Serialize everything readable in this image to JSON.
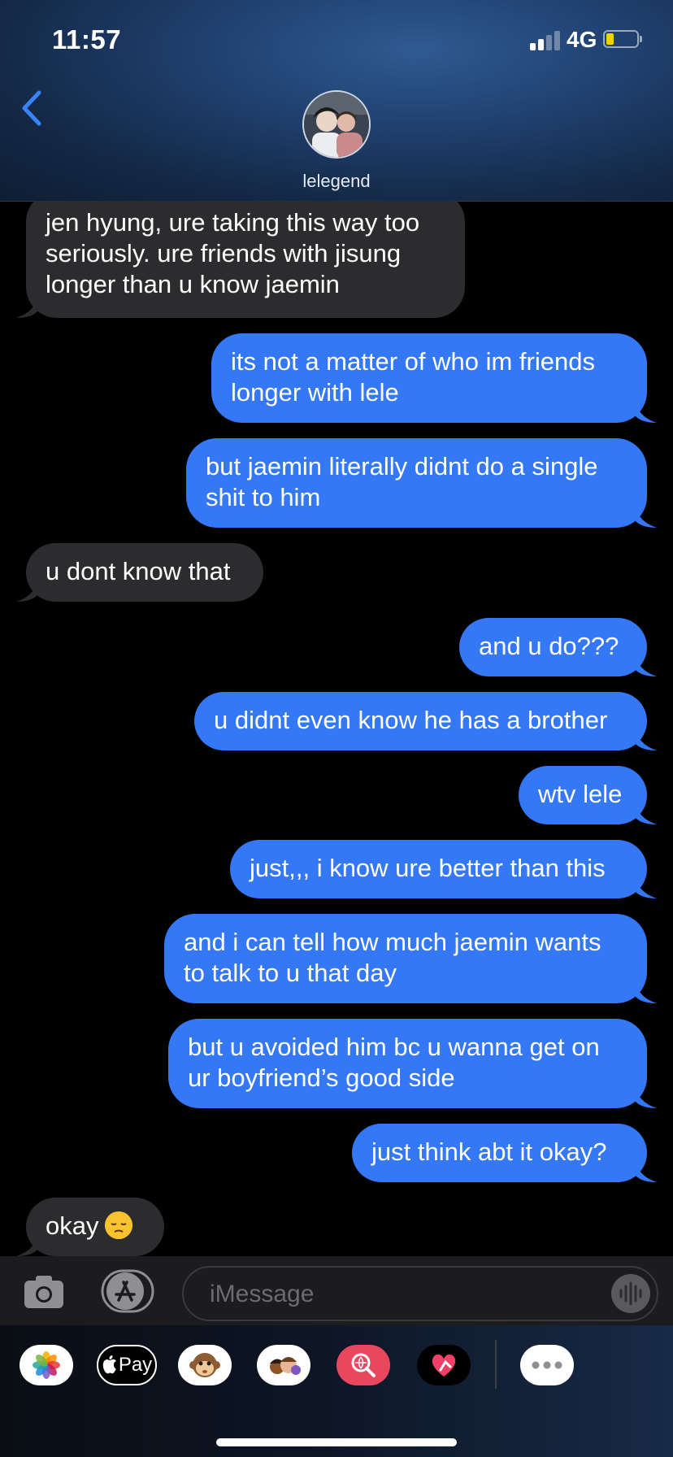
{
  "status_bar": {
    "time": "11:57",
    "network": "4G",
    "battery_level_fraction": 0.25,
    "battery_color": "#f6d000",
    "signal_bars_active": 2,
    "signal_bars_total": 4
  },
  "header": {
    "back_icon": "chevron-left-icon",
    "contact_name": "lelegend",
    "avatar_icon": "contact-photo"
  },
  "messages": [
    {
      "direction": "in",
      "text": "jen hyung, ure taking this way too seriously. ure friends with jisung longer than u know jaemin"
    },
    {
      "direction": "out",
      "text": "its not a matter of who im friends longer with lele"
    },
    {
      "direction": "out",
      "text": "but jaemin literally didnt do a single shit to him"
    },
    {
      "direction": "in",
      "text": "u dont know that"
    },
    {
      "direction": "out",
      "text": "and u do???"
    },
    {
      "direction": "out",
      "text": "u didnt even know he has a brother"
    },
    {
      "direction": "out",
      "text": "wtv lele"
    },
    {
      "direction": "out",
      "text": "just,,, i know ure better than this"
    },
    {
      "direction": "out",
      "text": "and i can tell how much jaemin wants to talk to u that day"
    },
    {
      "direction": "out",
      "text": "but u avoided him bc u wanna get on ur boyfriend’s good side"
    },
    {
      "direction": "out",
      "text": "just think abt it okay?"
    },
    {
      "direction": "in",
      "text": "okay",
      "emoji": "pensive-face"
    }
  ],
  "input_bar": {
    "placeholder": "iMessage",
    "camera_icon": "camera-icon",
    "apps_icon": "app-store-icon",
    "audio_icon": "audio-waveform-icon"
  },
  "app_drawer": {
    "apps": [
      {
        "name": "photos-icon"
      },
      {
        "name": "apple-pay-icon",
        "label": "Pay"
      },
      {
        "name": "monkey-animoji-icon"
      },
      {
        "name": "memoji-icon"
      },
      {
        "name": "web-search-icon"
      },
      {
        "name": "digital-touch-icon"
      },
      {
        "name": "more-apps-icon"
      }
    ]
  },
  "colors": {
    "outgoing_bubble": "#3478f6",
    "incoming_bubble": "#2c2c2e",
    "background": "#000000"
  }
}
